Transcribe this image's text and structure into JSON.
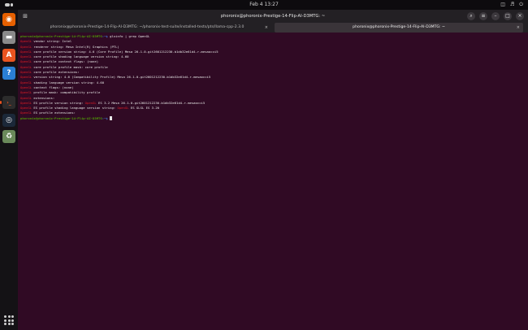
{
  "topbar": {
    "clock": "Feb 4  13:27",
    "tray_icons": [
      "network-icon",
      "volume-icon",
      "power-icon"
    ]
  },
  "dock": {
    "apps": [
      {
        "name": "firefox",
        "icon": "firefox-icon",
        "color": "#e66000",
        "glyph": "◉"
      },
      {
        "name": "files",
        "icon": "files-icon",
        "color": "#8a8a8a",
        "glyph": "▬"
      },
      {
        "name": "software",
        "icon": "software-icon",
        "color": "#e95420",
        "glyph": "A"
      },
      {
        "name": "help",
        "icon": "help-icon",
        "color": "#2a7fd4",
        "glyph": "?"
      },
      {
        "name": "terminal",
        "icon": "terminal-icon",
        "color": "#2c2c2c",
        "glyph": "›_"
      },
      {
        "name": "steam",
        "icon": "steam-icon",
        "color": "#1b2838",
        "glyph": "◎"
      },
      {
        "name": "trash",
        "icon": "trash-icon",
        "color": "#6a8a5a",
        "glyph": "♻"
      }
    ]
  },
  "window": {
    "title": "phoronix@phoronix-Prestige-14-Flip-AI-D3MTG: ~",
    "newtab_glyph": "⊞",
    "buttons": {
      "search": "⌕",
      "menu": "≡",
      "minimize": "–",
      "maximize": "□",
      "close": "×"
    },
    "tabs": [
      {
        "label": "phoronix@phoronix-Prestige-14-Flip-AI-D3MTG: ~/phoronix-test-suite/installed-tests/pts/llama-cpp-2.3.0",
        "close": "×"
      },
      {
        "label": "phoronix@phoronix-Prestige-14-Flip-AI-D3MTG: ~",
        "close": "×"
      }
    ]
  },
  "terminal": {
    "prompt_user": "phoronix@phoronix-Prestige-14-Flip-AI-D3MTG",
    "prompt_path": ":~$ ",
    "command": "glxinfo | grep OpenGL",
    "highlight_word": "OpenGL",
    "colors": {
      "user": "#4e9a06",
      "path": "#4470c8",
      "match": "#e01b24",
      "text": "#e8e8e8",
      "background": "#300a24"
    },
    "lines": [
      {
        "pre": "",
        "rest": " vendor string: Intel"
      },
      {
        "pre": "",
        "rest": " renderer string: Mesa Intel(R) Graphics (PTL)"
      },
      {
        "pre": "",
        "rest": " core profile version string: 4.6 (Core Profile) Mesa 26.1.0-git2601212230.b1db32e61d4-r-mesaocci5"
      },
      {
        "pre": "",
        "rest": " core profile shading language version string: 4.60"
      },
      {
        "pre": "",
        "rest": " core profile context flags: (none)"
      },
      {
        "pre": "",
        "rest": " core profile profile mask: core profile"
      },
      {
        "pre": "",
        "rest": " core profile extensions:"
      },
      {
        "pre": "",
        "rest": " version string: 4.6 (Compatibility Profile) Mesa 26.1.0-git2601212230.b1db32e61d4-r-mesaocci5"
      },
      {
        "pre": "",
        "rest": " shading language version string: 4.60"
      },
      {
        "pre": "",
        "rest": " context flags: (none)"
      },
      {
        "pre": "",
        "rest": " profile mask: compatibility profile"
      },
      {
        "pre": "",
        "rest": " extensions:"
      },
      {
        "pre": "",
        "rest": " ES profile version string: OpenGL ES 3.2 Mesa 26.1.0-git2601212230.b1db32e61d4-r-mesaocci5"
      },
      {
        "pre": "",
        "rest": " ES profile shading language version string: OpenGL ES GLSL ES 3.20"
      },
      {
        "pre": "",
        "rest": " ES profile extensions:"
      }
    ]
  }
}
